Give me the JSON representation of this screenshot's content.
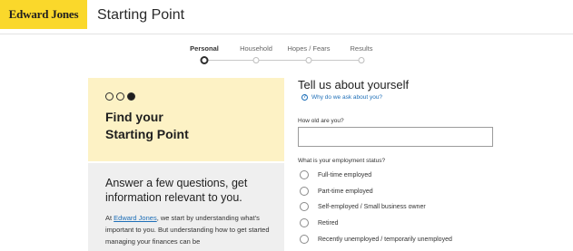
{
  "header": {
    "logo_text": "Edward Jones",
    "title": "Starting Point",
    "logo_color": "#fad82b"
  },
  "steps": [
    {
      "label": "Personal",
      "active": true
    },
    {
      "label": "Household",
      "active": false
    },
    {
      "label": "Hopes / Fears",
      "active": false
    },
    {
      "label": "Results",
      "active": false
    }
  ],
  "intro_card": {
    "progress": {
      "total": 3,
      "current": 3
    },
    "title_line1": "Find your",
    "title_line2": "Starting Point",
    "background_color": "#fdf2c5"
  },
  "info_card": {
    "heading": "Answer a few questions, get information relevant to you.",
    "body_prefix": "At ",
    "body_link": "Edward Jones",
    "body_suffix": ", we start by understanding what's important to you. But understanding how to get started managing your finances can be",
    "background_color": "#efefef"
  },
  "form": {
    "title": "Tell us about yourself",
    "why_link": "Why do we ask about you?",
    "age": {
      "label": "How old are you?",
      "value": "",
      "placeholder": ""
    },
    "employment": {
      "label": "What is your employment status?",
      "options": [
        "Full-time employed",
        "Part-time employed",
        "Self-employed / Small business owner",
        "Retired",
        "Recently unemployed / temporarily unemployed"
      ]
    },
    "link_color": "#1e6fb8"
  }
}
